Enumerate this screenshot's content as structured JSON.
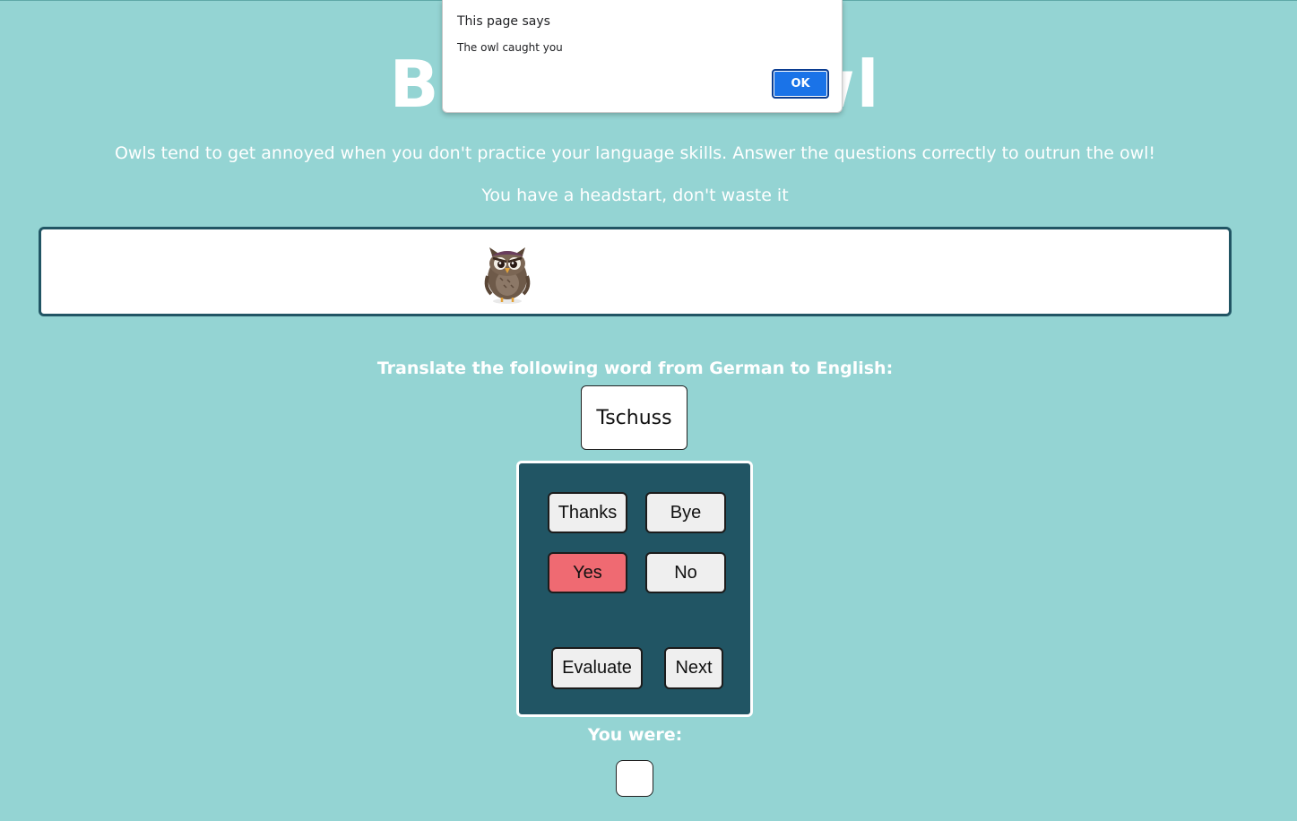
{
  "page": {
    "title": "Beat the Owl",
    "intro": "Owls tend to get annoyed when you don't practice your language skills. Answer the questions correctly to outrun the owl!",
    "headstart": "You have a headstart, don't waste it",
    "background_color": "#94d4d3",
    "panel_color": "#215564"
  },
  "track": {
    "character": "owl-icon"
  },
  "quiz": {
    "prompt": "Translate the following word from German to English:",
    "word": "Tschuss",
    "options": [
      "Thanks",
      "Bye",
      "Yes",
      "No"
    ],
    "selected_option": "Yes",
    "selected_color": "#ef6a72",
    "evaluate_label": "Evaluate",
    "next_label": "Next",
    "result_label": "You were:",
    "result_value": ""
  },
  "alert": {
    "title": "This page says",
    "message": "The owl caught you",
    "ok_label": "OK",
    "ok_color": "#1a73e8"
  }
}
